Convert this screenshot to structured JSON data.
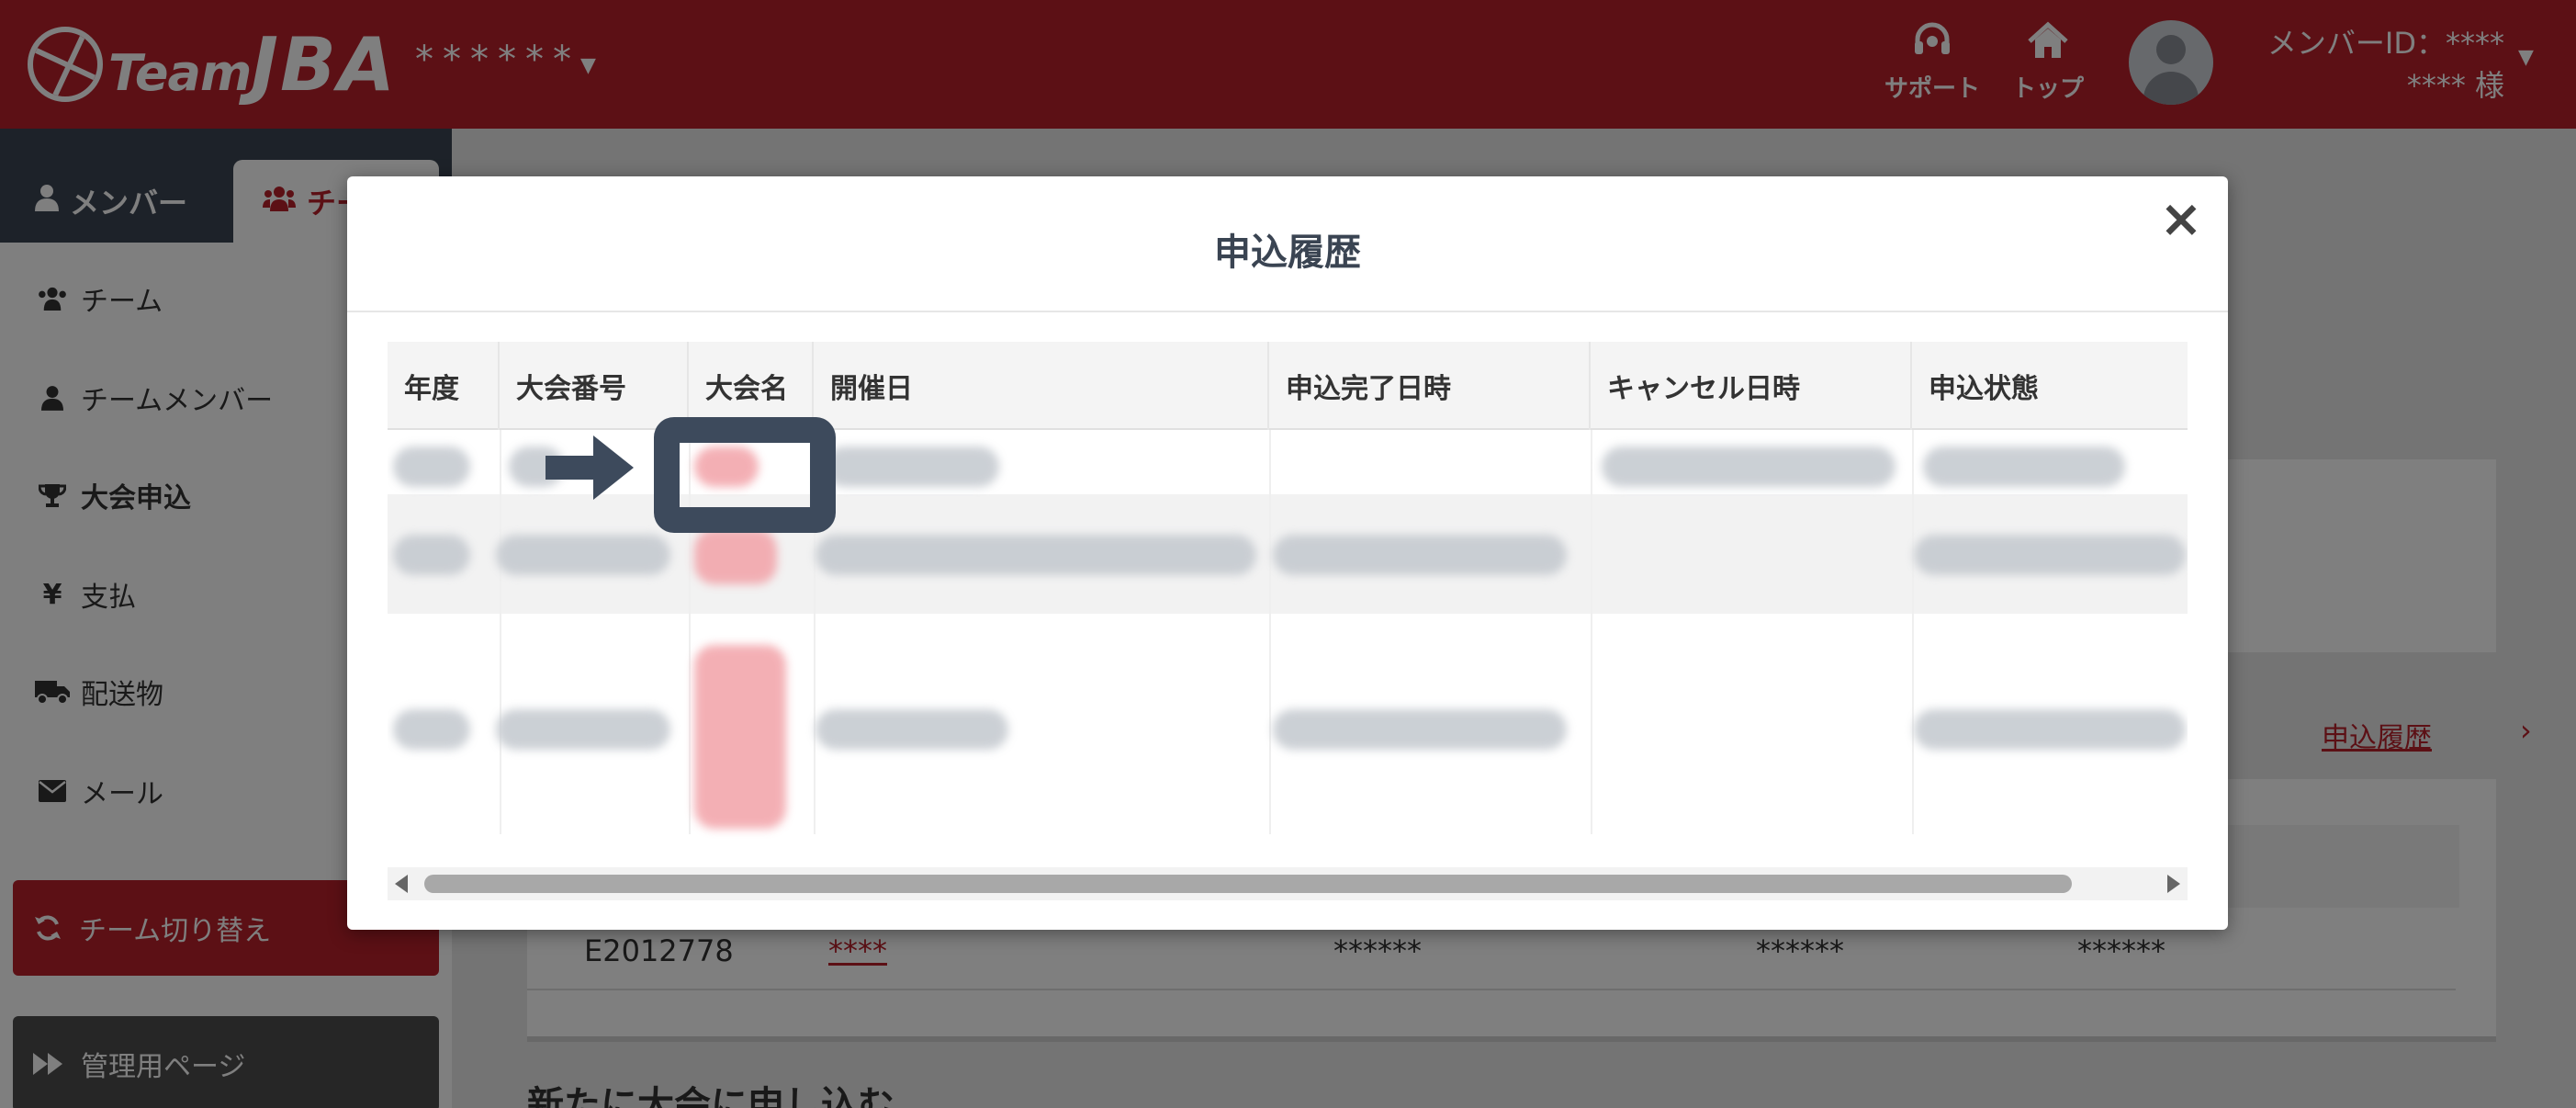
{
  "header": {
    "logo_text_1": "Team",
    "logo_text_2": "JBA",
    "team_name": "******",
    "nav": [
      {
        "label": "サポート",
        "icon": "headset-icon"
      },
      {
        "label": "トップ",
        "icon": "home-icon"
      }
    ],
    "member_id_line": "メンバーID：****",
    "member_name_line": "**** 様"
  },
  "sidebar": {
    "tabs": [
      {
        "label": "メンバー",
        "icon": "user-icon"
      },
      {
        "label": "チーム",
        "icon": "users-icon"
      }
    ],
    "items": [
      {
        "label": "チーム",
        "icon": "users-icon"
      },
      {
        "label": "チームメンバー",
        "icon": "user-icon"
      },
      {
        "label": "大会申込",
        "icon": "trophy-icon"
      },
      {
        "label": "支払",
        "icon": "yen-icon"
      },
      {
        "label": "配送物",
        "icon": "truck-icon"
      },
      {
        "label": "メール",
        "icon": "envelope-icon"
      }
    ],
    "switch_team_label": "チーム切り替え",
    "admin_label": "管理用ページ"
  },
  "main": {
    "history_link": "申込履歴",
    "row": {
      "code": "E2012778",
      "name": "****",
      "col3": "******",
      "col4": "******",
      "col5": "******"
    },
    "new_heading": "新たに大会に申し込む"
  },
  "modal": {
    "title": "申込履歴",
    "close_label": "×",
    "columns": [
      "年度",
      "大会番号",
      "大会名",
      "開催日",
      "申込完了日時",
      "キャンセル日時",
      "申込状態"
    ]
  },
  "colors": {
    "brand_red": "#b9202b",
    "sidebar_dark": "#3a4452",
    "annotation": "#3d4a5c"
  }
}
